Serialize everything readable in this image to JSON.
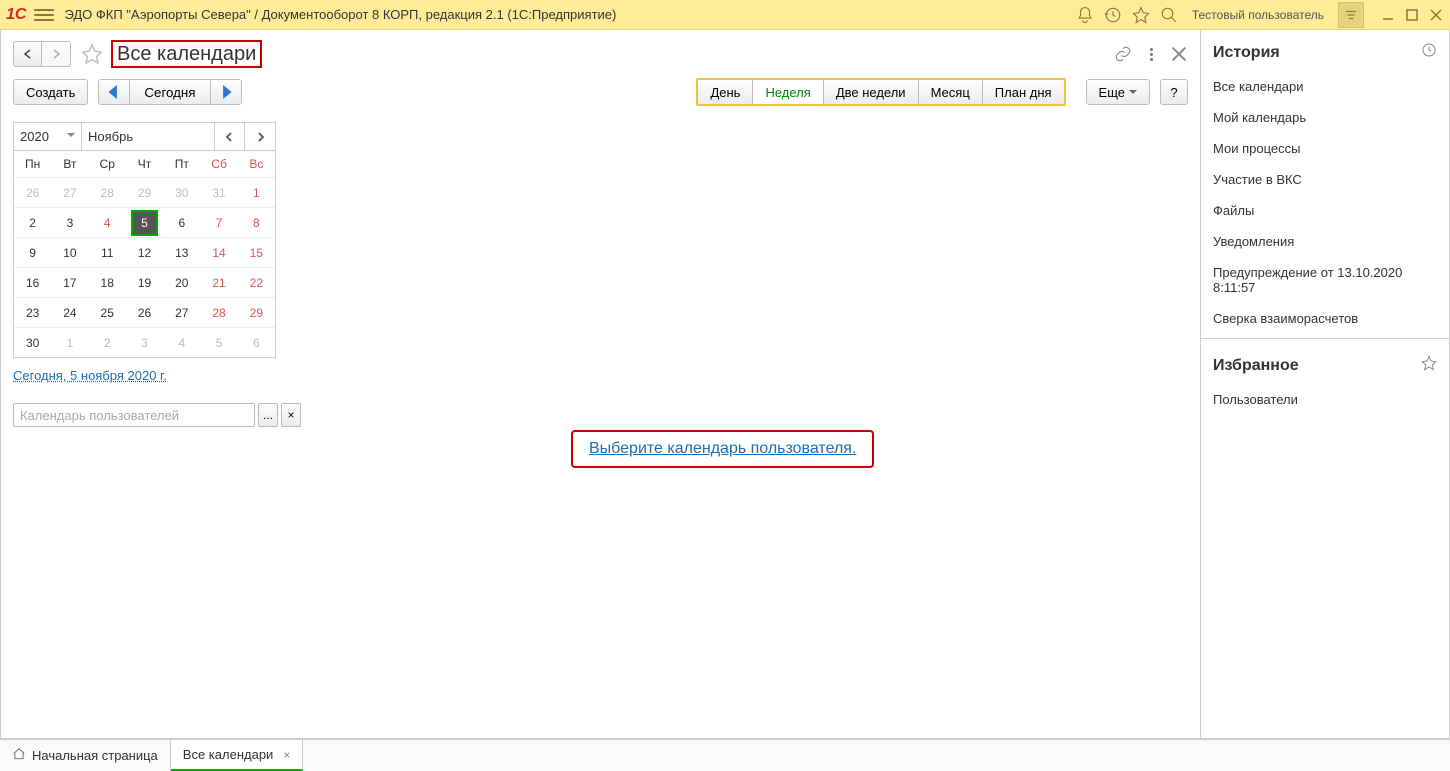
{
  "titlebar": {
    "app_title": "ЭДО ФКП \"Аэропорты Севера\" / Документооборот 8 КОРП, редакция 2.1  (1С:Предприятие)",
    "user": "Тестовый пользователь"
  },
  "page": {
    "title": "Все календари",
    "create_btn": "Создать",
    "today_btn": "Сегодня",
    "more_btn": "Еще",
    "help_btn": "?",
    "views": {
      "day": "День",
      "week": "Неделя",
      "two_weeks": "Две недели",
      "month": "Месяц",
      "day_plan": "План дня"
    }
  },
  "calendar": {
    "year": "2020",
    "month": "Ноябрь",
    "dow": [
      "Пн",
      "Вт",
      "Ср",
      "Чт",
      "Пт",
      "Сб",
      "Вс"
    ],
    "weeks": [
      [
        {
          "d": "26",
          "dim": true
        },
        {
          "d": "27",
          "dim": true
        },
        {
          "d": "28",
          "dim": true
        },
        {
          "d": "29",
          "dim": true
        },
        {
          "d": "30",
          "dim": true
        },
        {
          "d": "31",
          "dim": true
        },
        {
          "d": "1",
          "we": true
        }
      ],
      [
        {
          "d": "2"
        },
        {
          "d": "3"
        },
        {
          "d": "4",
          "we": true
        },
        {
          "d": "5",
          "today": true
        },
        {
          "d": "6"
        },
        {
          "d": "7",
          "we": true
        },
        {
          "d": "8",
          "we": true
        }
      ],
      [
        {
          "d": "9"
        },
        {
          "d": "10"
        },
        {
          "d": "11"
        },
        {
          "d": "12"
        },
        {
          "d": "13"
        },
        {
          "d": "14",
          "we": true
        },
        {
          "d": "15",
          "we": true
        }
      ],
      [
        {
          "d": "16"
        },
        {
          "d": "17"
        },
        {
          "d": "18"
        },
        {
          "d": "19"
        },
        {
          "d": "20"
        },
        {
          "d": "21",
          "we": true
        },
        {
          "d": "22",
          "we": true
        }
      ],
      [
        {
          "d": "23"
        },
        {
          "d": "24"
        },
        {
          "d": "25"
        },
        {
          "d": "26"
        },
        {
          "d": "27"
        },
        {
          "d": "28",
          "we": true
        },
        {
          "d": "29",
          "we": true
        }
      ],
      [
        {
          "d": "30"
        },
        {
          "d": "1",
          "dim": true
        },
        {
          "d": "2",
          "dim": true
        },
        {
          "d": "3",
          "dim": true
        },
        {
          "d": "4",
          "dim": true
        },
        {
          "d": "5",
          "dim": true
        },
        {
          "d": "6",
          "dim": true
        }
      ]
    ],
    "today_link": "Сегодня, 5 ноября 2020 г.",
    "user_cal_placeholder": "Календарь пользователей",
    "ellipsis": "...",
    "clear": "×"
  },
  "center_link": "Выберите календарь пользователя.",
  "history": {
    "title": "История",
    "items": [
      "Все календари",
      "Мой календарь",
      "Мои процессы",
      "Участие в ВКС",
      "Файлы",
      "Уведомления",
      "Предупреждение от 13.10.2020 8:11:57",
      "Сверка взаиморасчетов"
    ]
  },
  "favorites": {
    "title": "Избранное",
    "items": [
      "Пользователи"
    ]
  },
  "bottom_tabs": {
    "home": "Начальная страница",
    "current": "Все календари"
  }
}
